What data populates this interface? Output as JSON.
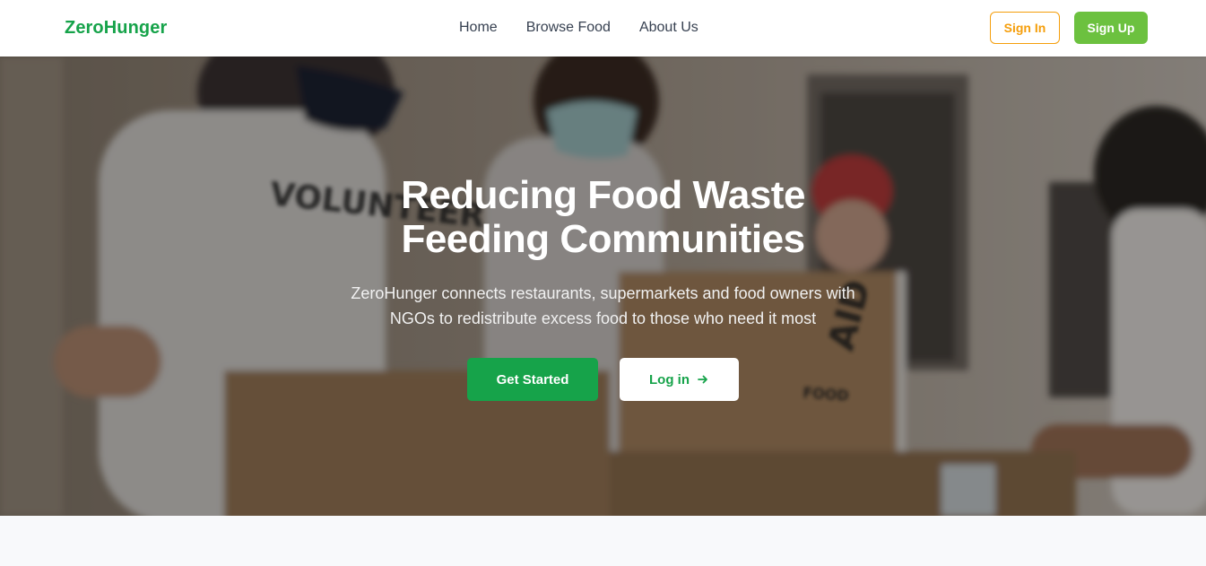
{
  "navbar": {
    "logo": "ZeroHunger",
    "links": [
      "Home",
      "Browse Food",
      "About Us"
    ],
    "sign_in": "Sign In",
    "sign_up": "Sign Up"
  },
  "hero": {
    "title_line1": "Reducing Food Waste",
    "title_line2": "Feeding Communities",
    "subtitle_line1": "ZeroHunger connects restaurants, supermarkets and food owners with",
    "subtitle_line2": "NGOs to redistribute excess food to those who need it most",
    "get_started": "Get Started",
    "log_in": "Log in",
    "login_icon": "arrow-right-icon",
    "image_shirt_text": "VOLUNTEER",
    "image_box_text_1": "AID",
    "image_box_text_2": "FOOD"
  },
  "colors": {
    "brand_green": "#16a34a",
    "signup_green": "#6cc13f",
    "signin_orange": "#f59e0b"
  }
}
